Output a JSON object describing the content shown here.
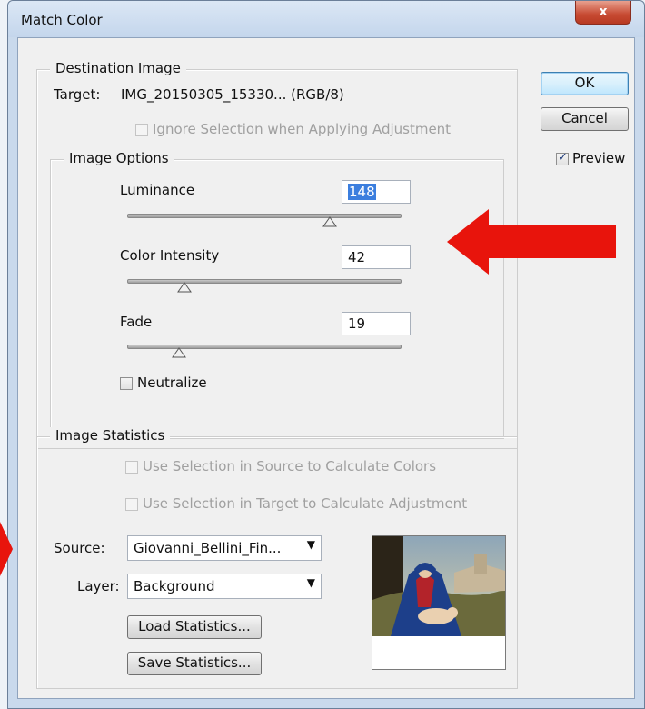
{
  "window": {
    "title": "Match Color",
    "close_glyph": "x"
  },
  "buttons": {
    "ok": "OK",
    "cancel": "Cancel"
  },
  "preview": {
    "label": "Preview",
    "checked": true
  },
  "destination": {
    "group_label": "Destination Image",
    "target_prefix": "Target:",
    "target_value": "IMG_20150305_15330... (RGB/8)",
    "ignore_selection_label": "Ignore Selection when Applying Adjustment"
  },
  "image_options": {
    "group_label": "Image Options",
    "luminance": {
      "label": "Luminance",
      "value": "148",
      "slider_fraction": 0.74
    },
    "color_intensity": {
      "label": "Color Intensity",
      "value": "42",
      "slider_fraction": 0.21
    },
    "fade": {
      "label": "Fade",
      "value": "19",
      "slider_fraction": 0.19
    },
    "neutralize_label": "Neutralize"
  },
  "statistics": {
    "group_label": "Image Statistics",
    "use_source_label": "Use Selection in Source to Calculate Colors",
    "use_target_label": "Use Selection in Target to Calculate Adjustment",
    "source_label": "Source:",
    "source_value": "Giovanni_Bellini_Fin...",
    "layer_label": "Layer:",
    "layer_value": "Background",
    "load_button": "Load Statistics...",
    "save_button": "Save Statistics..."
  },
  "colors": {
    "annotation_arrow": "#e8140c",
    "selection": "#3b7ede"
  }
}
